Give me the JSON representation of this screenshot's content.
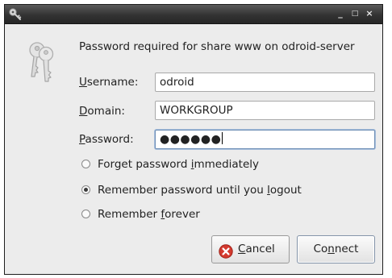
{
  "window": {
    "controls": {
      "minimize": "_",
      "maximize": "□",
      "close": "×"
    }
  },
  "dialog": {
    "message": "Password required for share www on odroid-server",
    "icon": "keys-icon",
    "fields": {
      "username": {
        "label_mnemonic": "U",
        "label_rest": "sername:",
        "value": "odroid"
      },
      "domain": {
        "label_mnemonic": "D",
        "label_rest": "omain:",
        "value": "WORKGROUP"
      },
      "password": {
        "label_mnemonic": "P",
        "label_rest": "assword:",
        "masked_value": "●●●●●●"
      }
    },
    "options": [
      {
        "before": "Forget password ",
        "mnemonic": "i",
        "after": "mmediately",
        "checked": false
      },
      {
        "before": "Remember password until you ",
        "mnemonic": "l",
        "after": "ogout",
        "checked": true
      },
      {
        "before": "Remember ",
        "mnemonic": "f",
        "after": "orever",
        "checked": false
      }
    ],
    "buttons": {
      "cancel": {
        "mnemonic": "C",
        "rest": "ancel",
        "icon": "cancel-icon"
      },
      "connect": {
        "before": "Co",
        "mnemonic": "n",
        "after": "nect"
      }
    }
  },
  "colors": {
    "titlebar": "#333333",
    "dialog_bg": "#ececec",
    "cancel_icon": "#d43a2f",
    "focus_border": "#6f8fb6"
  }
}
